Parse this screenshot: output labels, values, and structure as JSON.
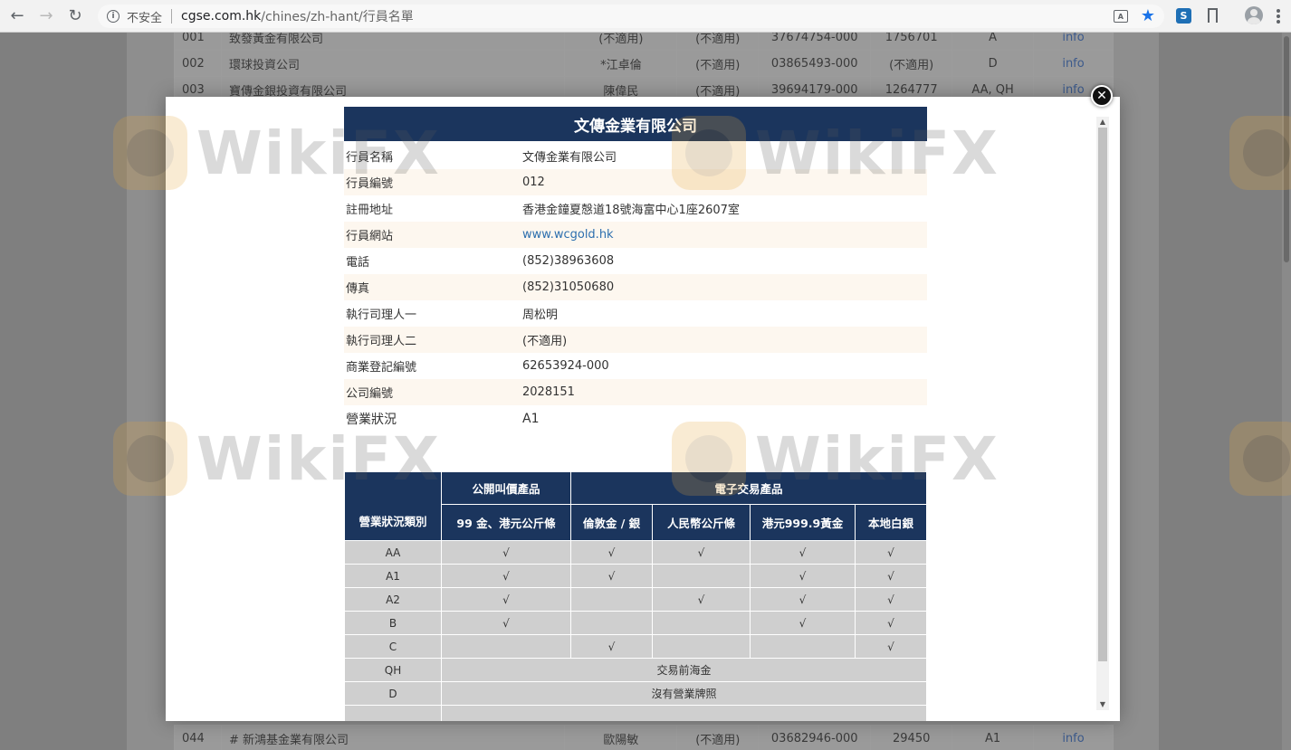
{
  "browser": {
    "insecure_label": "不安全",
    "url_host": "cgse.com.hk",
    "url_path": "/chines/zh-hant/行員名單",
    "translate_icon": "translate-icon",
    "star_icon": "star-icon"
  },
  "background_table": {
    "top_rows": [
      {
        "no": "001",
        "name": "致發黃金有限公司",
        "person": "(不適用)",
        "na": "(不適用)",
        "reg": "37674754-000",
        "co": "1756701",
        "cat": "A",
        "link": "info"
      },
      {
        "no": "002",
        "name": "環球投資公司",
        "person": "*江卓倫",
        "na": "(不適用)",
        "reg": "03865493-000",
        "co": "(不適用)",
        "cat": "D",
        "link": "info"
      },
      {
        "no": "003",
        "name": "寶傳金銀投資有限公司",
        "person": "陳偉民",
        "na": "(不適用)",
        "reg": "39694179-000",
        "co": "1264777",
        "cat": "AA, QH",
        "link": "info"
      }
    ],
    "bottom_rows": [
      {
        "no": "044",
        "name": "# 新鴻基金業有限公司",
        "person": "歐陽敏",
        "na": "(不適用)",
        "reg": "03682946-000",
        "co": "29450",
        "cat": "A1",
        "link": "info"
      }
    ]
  },
  "modal": {
    "title": "文傳金業有限公司",
    "rows": [
      {
        "label": "行員名稱",
        "value": "文傳金業有限公司"
      },
      {
        "label": "行員編號",
        "value": "012"
      },
      {
        "label": "註冊地址",
        "value": "香港金鐘夏慤道18號海富中心1座2607室"
      },
      {
        "label": "行員網站",
        "value": "www.wcgold.hk"
      },
      {
        "label": "電話",
        "value": "(852)38963608"
      },
      {
        "label": "傳真",
        "value": "(852)31050680"
      },
      {
        "label": "執行司理人一",
        "value": "周松明"
      },
      {
        "label": "執行司理人二",
        "value": "(不適用)"
      },
      {
        "label": "商業登記編號",
        "value": "62653924-000"
      },
      {
        "label": "公司編號",
        "value": "2028151"
      },
      {
        "label": "營業狀況",
        "value": "A1"
      }
    ],
    "category_table": {
      "header_category": "營業狀況類別",
      "group_public": "公開叫價產品",
      "group_electronic": "電子交易產品",
      "col_99": "99 金、港元公斤條",
      "col_london": "倫敦金 / 銀",
      "col_rmb": "人民幣公斤條",
      "col_hkd999": "港元999.9黃金",
      "col_local_silver": "本地白銀",
      "check": "√",
      "rows": [
        {
          "code": "AA",
          "cells": [
            "√",
            "√",
            "√",
            "√",
            "√"
          ]
        },
        {
          "code": "A1",
          "cells": [
            "√",
            "√",
            "",
            "√",
            "√"
          ]
        },
        {
          "code": "A2",
          "cells": [
            "√",
            "",
            "√",
            "√",
            "√"
          ]
        },
        {
          "code": "B",
          "cells": [
            "√",
            "",
            "",
            "√",
            "√"
          ]
        },
        {
          "code": "C",
          "cells": [
            "",
            "√",
            "",
            "",
            "√"
          ]
        }
      ],
      "qh_code": "QH",
      "qh_text": "交易前海金",
      "d_code": "D",
      "d_text": "沒有營業牌照"
    }
  },
  "watermark": {
    "text": "WikiFX"
  }
}
